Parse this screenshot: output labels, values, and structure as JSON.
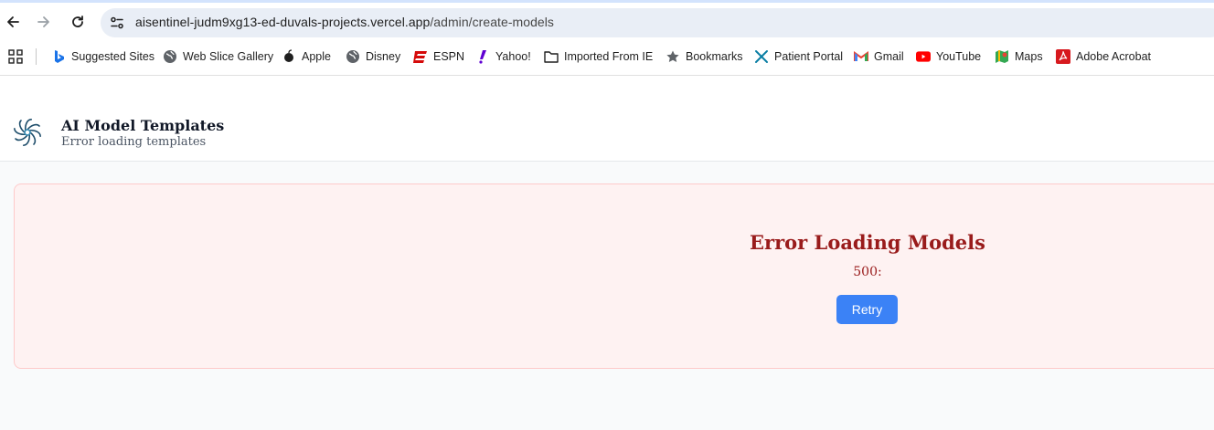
{
  "browser": {
    "url_host": "aisentinel-judm9xg13-ed-duvals-projects.vercel.app",
    "url_path": "/admin/create-models",
    "nav_icons": [
      "back-arrow-icon",
      "forward-arrow-icon",
      "reload-icon",
      "site-info-icon"
    ]
  },
  "bookmarks": [
    {
      "label": "Suggested Sites",
      "icon": "bing-icon"
    },
    {
      "label": "Web Slice Gallery",
      "icon": "globe-icon"
    },
    {
      "label": "Apple",
      "icon": "apple-icon"
    },
    {
      "label": "Disney",
      "icon": "globe-icon"
    },
    {
      "label": "ESPN",
      "icon": "espn-icon"
    },
    {
      "label": "Yahoo!",
      "icon": "yahoo-icon"
    },
    {
      "label": "Imported From IE",
      "icon": "folder-icon"
    },
    {
      "label": "Bookmarks",
      "icon": "star-icon"
    },
    {
      "label": "Patient Portal",
      "icon": "patient-portal-icon"
    },
    {
      "label": "Gmail",
      "icon": "gmail-icon"
    },
    {
      "label": "YouTube",
      "icon": "youtube-icon"
    },
    {
      "label": "Maps",
      "icon": "maps-icon"
    },
    {
      "label": "Adobe Acrobat",
      "icon": "acrobat-icon"
    }
  ],
  "header": {
    "title": "AI Model Templates",
    "subtitle": "Error loading templates"
  },
  "error": {
    "title": "Error Loading Models",
    "message": "500:",
    "retry_label": "Retry"
  },
  "colors": {
    "error_text": "#991b1b",
    "error_bg": "#fef2f2",
    "error_border": "#fecaca",
    "button": "#3b82f6"
  }
}
